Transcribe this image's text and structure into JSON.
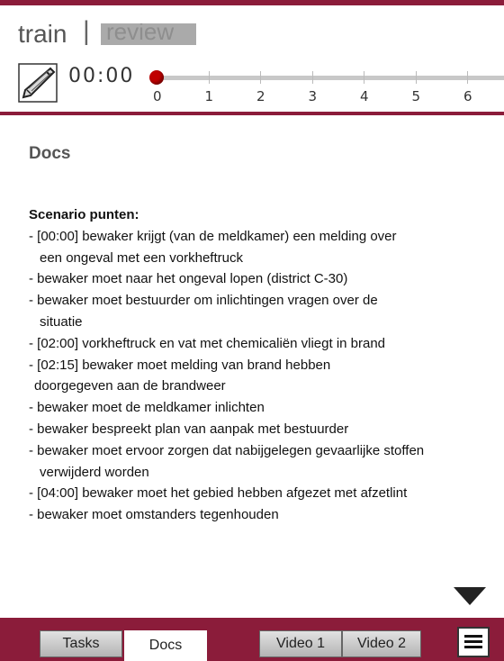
{
  "modes": {
    "train": "train",
    "separator": "|",
    "review": "review"
  },
  "timer": "00:00",
  "timeline_ticks": [
    "0",
    "1",
    "2",
    "3",
    "4",
    "5",
    "6"
  ],
  "timeline_position_minutes": 0,
  "doc": {
    "title": "Docs",
    "heading": "Scenario punten:",
    "lines": [
      {
        "text": "- [00:00] bewaker krijgt (van de meldkamer) een melding over",
        "indent": ""
      },
      {
        "text": "een ongeval met een vorkheftruck",
        "indent": "indent"
      },
      {
        "text": "- bewaker moet naar het ongeval lopen (district C-30)",
        "indent": ""
      },
      {
        "text": "- bewaker moet bestuurder om inlichtingen vragen over de",
        "indent": ""
      },
      {
        "text": "situatie",
        "indent": "indent"
      },
      {
        "text": "- [02:00] vorkheftruck en vat met chemicaliën vliegt in brand",
        "indent": ""
      },
      {
        "text": "- [02:15] bewaker moet melding van brand hebben",
        "indent": ""
      },
      {
        "text": "doorgegeven aan de brandweer",
        "indent": "indent-sm"
      },
      {
        "text": "- bewaker moet de meldkamer inlichten",
        "indent": ""
      },
      {
        "text": "- bewaker bespreekt plan van aanpak met bestuurder",
        "indent": ""
      },
      {
        "text": "- bewaker moet ervoor zorgen dat nabijgelegen gevaarlijke stoffen",
        "indent": ""
      },
      {
        "text": "verwijderd worden",
        "indent": "indent"
      },
      {
        "text": "- [04:00] bewaker moet het gebied hebben afgezet met afzetlint",
        "indent": ""
      },
      {
        "text": "- bewaker moet omstanders tegenhouden",
        "indent": ""
      }
    ]
  },
  "tabs": [
    {
      "label": "Tasks",
      "active": false
    },
    {
      "label": "Docs",
      "active": true
    },
    {
      "label": "Video 1",
      "active": false
    },
    {
      "label": "Video 2",
      "active": false
    }
  ],
  "colors": {
    "accent": "#8b1c3a",
    "timeline_knob": "#c00000"
  },
  "icons": {
    "edit": "pencil-icon",
    "scroll": "scroll-down-arrow-icon",
    "menu": "menu-icon"
  }
}
